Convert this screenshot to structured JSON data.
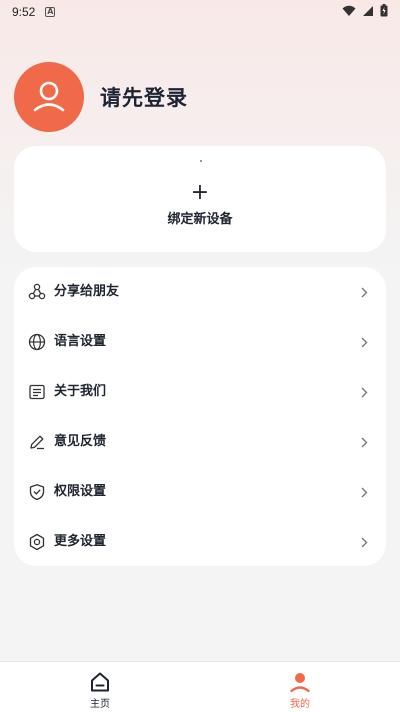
{
  "status_bar": {
    "time": "9:52",
    "icons": [
      "text-input-a-icon",
      "wifi-icon",
      "signal-icon",
      "battery-icon"
    ]
  },
  "profile": {
    "login_prompt": "请先登录",
    "avatar_icon": "user-avatar-icon",
    "avatar_color": "#f06a4a"
  },
  "device": {
    "add_icon": "plus-icon",
    "plus_glyph": "+",
    "bind_label": "绑定新设备"
  },
  "menu": {
    "items": [
      {
        "label": "分享给朋友",
        "icon": "share-icon"
      },
      {
        "label": "语言设置",
        "icon": "globe-icon"
      },
      {
        "label": "关于我们",
        "icon": "document-icon"
      },
      {
        "label": "意见反馈",
        "icon": "edit-pen-icon"
      },
      {
        "label": "权限设置",
        "icon": "shield-icon"
      },
      {
        "label": "更多设置",
        "icon": "hexagon-settings-icon"
      }
    ]
  },
  "bottom_nav": {
    "home_label": "主页",
    "mine_label": "我的",
    "active": "我的",
    "accent_color": "#f06a4a"
  }
}
